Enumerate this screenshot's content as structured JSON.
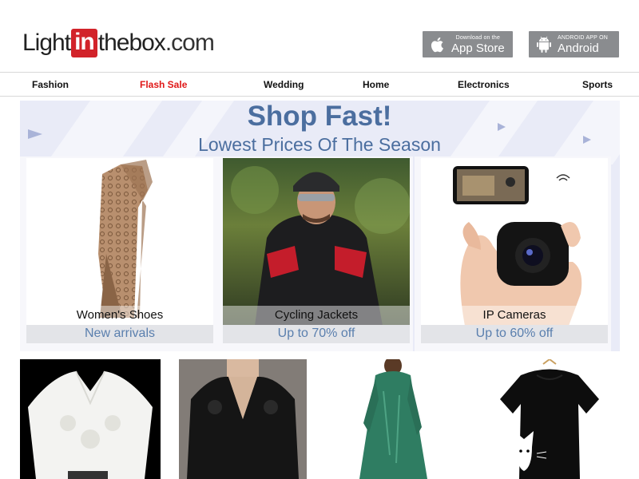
{
  "header": {
    "logo": {
      "part1": "Light",
      "part2": "in",
      "part3": "thebox",
      "part4": ".com"
    },
    "app_store": {
      "small": "Download on the",
      "big": "App Store",
      "icon": "apple-icon"
    },
    "android": {
      "small": "ANDROID APP ON",
      "big": "Android",
      "icon": "android-icon"
    }
  },
  "nav": {
    "items": [
      {
        "label": "Fashion"
      },
      {
        "label": "Flash Sale",
        "highlight": "#e01717"
      },
      {
        "label": "Wedding"
      },
      {
        "label": "Home"
      },
      {
        "label": "Electronics"
      },
      {
        "label": "Sports"
      }
    ]
  },
  "banner": {
    "title": "Shop Fast!",
    "subtitle": "Lowest Prices Of The Season",
    "cards": [
      {
        "label": "Women's Shoes",
        "sublabel": "New arrivals"
      },
      {
        "label": "Cycling Jackets",
        "sublabel": "Up to 70% off"
      },
      {
        "label": "IP Cameras",
        "sublabel": "Up to 60% off"
      }
    ]
  },
  "colors": {
    "accent": "#d2232a",
    "banner_text": "#4b6e9f",
    "sale": "#e01717",
    "store_btn": "#8a8c8f"
  }
}
